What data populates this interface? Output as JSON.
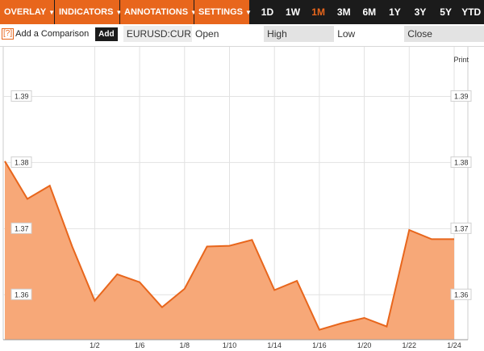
{
  "toolbar": {
    "overlay": "OVERLAY",
    "indicators": "INDICATORS",
    "annotations": "ANNOTATIONS",
    "settings": "SETTINGS",
    "caret_icon": "triangle-down-icon",
    "ranges": [
      "1D",
      "1W",
      "1M",
      "3M",
      "6M",
      "1Y",
      "3Y",
      "5Y",
      "YTD"
    ],
    "active_range": "1M"
  },
  "compare": {
    "help": "[?]",
    "label": "Add a Comparison",
    "add": "Add"
  },
  "quote": {
    "ticker": "EURUSD:CUR",
    "open": "Open",
    "high": "High",
    "low": "Low",
    "close": "Close"
  },
  "print": "Print",
  "colors": {
    "accent": "#e8661c",
    "fill": "#f7a878",
    "bar": "#1b1b1b"
  },
  "chart_data": {
    "type": "area",
    "x": [
      "12/25",
      "12/27",
      "12/30",
      "12/31",
      "1/2",
      "1/3",
      "1/6",
      "1/7",
      "1/8",
      "1/9",
      "1/10",
      "1/13",
      "1/14",
      "1/15",
      "1/16",
      "1/17",
      "1/20",
      "1/21",
      "1/22",
      "1/23",
      "1/24"
    ],
    "values": [
      1.3802,
      1.3745,
      1.3765,
      1.3673,
      1.3591,
      1.3631,
      1.3619,
      1.3581,
      1.3609,
      1.3673,
      1.3674,
      1.3683,
      1.3607,
      1.3621,
      1.3547,
      1.3557,
      1.3565,
      1.3552,
      1.3698,
      1.3684,
      1.3684
    ],
    "xtick_labels": [
      "1/2",
      "1/6",
      "1/8",
      "1/10",
      "1/14",
      "1/16",
      "1/20",
      "1/22",
      "1/24"
    ],
    "ytick_labels": [
      "1.39",
      "1.38",
      "1.37",
      "1.36"
    ],
    "yticks": [
      1.39,
      1.38,
      1.37,
      1.36
    ],
    "ylim": [
      1.3532,
      1.3975
    ],
    "grid": true,
    "title": "",
    "xlabel": "",
    "ylabel": ""
  }
}
